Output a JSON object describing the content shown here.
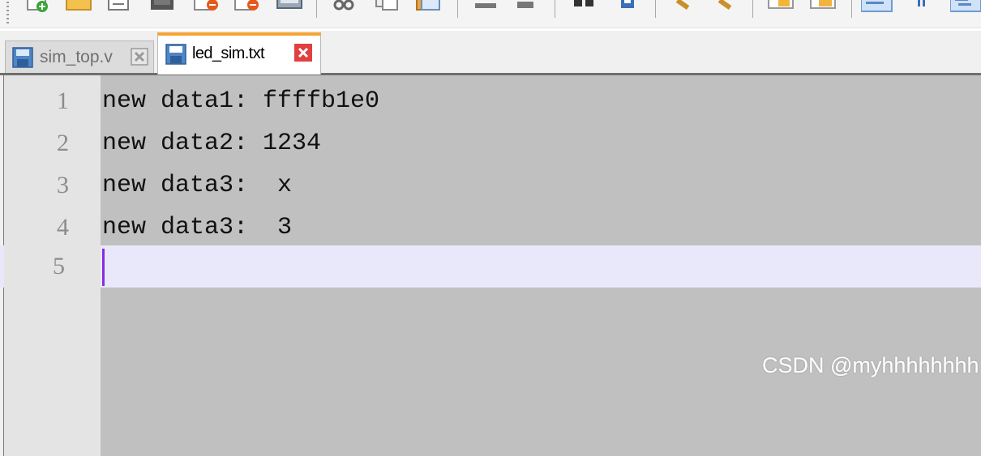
{
  "toolbar": {
    "icons": [
      "new-file-icon",
      "open-folder-icon",
      "save-icon",
      "save-all-icon",
      "close-icon",
      "close-all-icon",
      "print-icon",
      "cut-icon",
      "copy-icon",
      "paste-icon",
      "undo-icon",
      "redo-icon",
      "find-icon",
      "replace-icon",
      "zoom-in-icon",
      "zoom-out-icon",
      "sync-vertical-icon",
      "sync-horizontal-icon",
      "word-wrap-icon",
      "show-all-chars-icon",
      "indent-guide-icon"
    ]
  },
  "tabs": [
    {
      "label": "sim_top.v",
      "active": false,
      "icon": "save-disk-icon"
    },
    {
      "label": "led_sim.txt",
      "active": true,
      "icon": "save-disk-icon"
    }
  ],
  "editor": {
    "lines": [
      {
        "number": "1",
        "text": "new data1: ffffb1e0"
      },
      {
        "number": "2",
        "text": "new data2: 1234"
      },
      {
        "number": "3",
        "text": "new data3:  x"
      },
      {
        "number": "4",
        "text": "new data3:  3"
      },
      {
        "number": "5",
        "text": ""
      }
    ],
    "current_line": 5
  },
  "watermark": "CSDN @myhhhhhhhh",
  "colors": {
    "active_tab_accent": "#f6a437",
    "editor_background": "#c0c0c0",
    "current_line_highlight": "#e8e8fa",
    "caret": "#8a2be2",
    "close_button": "#e04040"
  }
}
